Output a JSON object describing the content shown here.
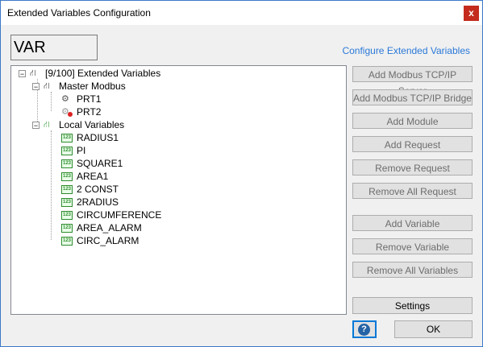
{
  "window": {
    "title": "Extended Variables Configuration",
    "close": "x"
  },
  "header": {
    "name_value": "VAR",
    "link_label": "Configure Extended Variables"
  },
  "tree": {
    "root": "[9/100] Extended Variables",
    "master": "Master Modbus",
    "ports": [
      "PRT1",
      "PRT2"
    ],
    "local": "Local Variables",
    "variables": [
      "RADIUS1",
      "PI",
      "SQUARE1",
      "AREA1",
      "2 CONST",
      "2RADIUS",
      "CIRCUMFERENCE",
      "AREA_ALARM",
      "CIRC_ALARM"
    ],
    "var_icon_text": "123"
  },
  "buttons": {
    "add_tcp_server": "Add Modbus TCP/IP Server",
    "add_tcp_bridge": "Add Modbus TCP/IP Bridge",
    "add_module": "Add Module",
    "add_request": "Add Request",
    "remove_request": "Remove Request",
    "remove_all_request": "Remove All Request",
    "add_variable": "Add Variable",
    "remove_variable": "Remove Variable",
    "remove_all_variables": "Remove All Variables",
    "settings": "Settings",
    "help": "?",
    "ok": "OK"
  },
  "colors": {
    "link": "#2a78d8",
    "close": "#c42b1c",
    "accent": "#0078d7"
  }
}
